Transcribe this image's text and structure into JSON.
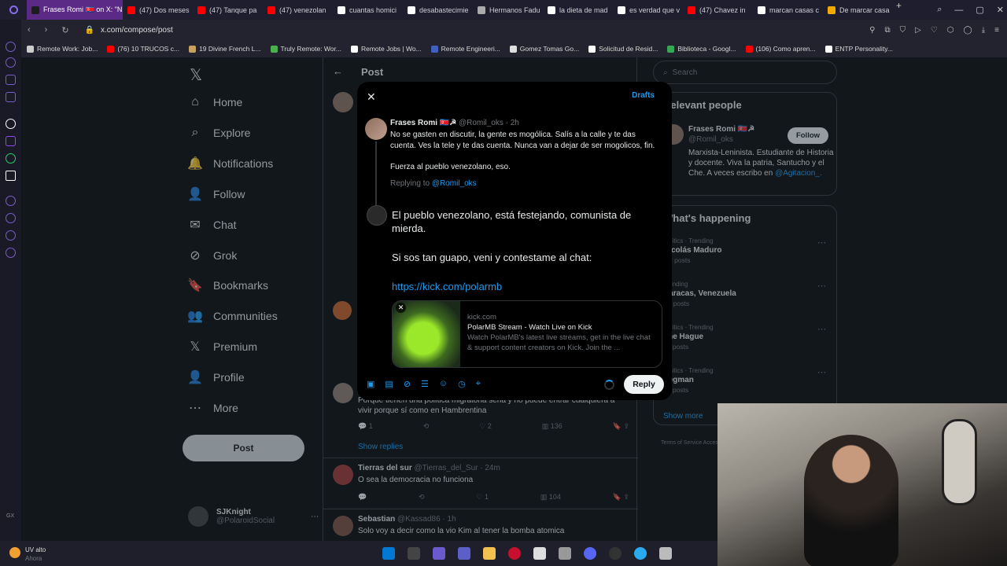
{
  "browser": {
    "tabs": [
      {
        "label": "Frases Romi 🇰🇵 on X: \"N",
        "color": "#1d1d1d",
        "active": true
      },
      {
        "label": "(47) Dos meses",
        "color": "#ff0000"
      },
      {
        "label": "(47) Tanque pa",
        "color": "#ff0000"
      },
      {
        "label": "(47) venezolan",
        "color": "#ff0000"
      },
      {
        "label": "cuantas homici",
        "color": "#ffffff"
      },
      {
        "label": "desabastecimie",
        "color": "#ffffff"
      },
      {
        "label": "Hermanos Fadu",
        "color": "#aaaaaa"
      },
      {
        "label": "la dieta de mad",
        "color": "#ffffff"
      },
      {
        "label": "es verdad que v",
        "color": "#ffffff"
      },
      {
        "label": "(47) Chavez in",
        "color": "#ff0000"
      },
      {
        "label": "marcan casas c",
        "color": "#ffffff"
      },
      {
        "label": "De marcar casa",
        "color": "#f2a900"
      }
    ],
    "url": "x.com/compose/post",
    "bookmarks": [
      {
        "label": "Remote Work: Job...",
        "color": "#cccccc"
      },
      {
        "label": "(76) 10 TRUCOS c...",
        "color": "#ff0000"
      },
      {
        "label": "19 Divine French L...",
        "color": "#c8a060"
      },
      {
        "label": "Truly Remote: Wor...",
        "color": "#4caf50"
      },
      {
        "label": "Remote Jobs | Wo...",
        "color": "#ffffff"
      },
      {
        "label": "Remote Engineeri...",
        "color": "#4060c0"
      },
      {
        "label": "Gomez Tomas Go...",
        "color": "#dddddd"
      },
      {
        "label": "Solicitud de Resid...",
        "color": "#ffffff"
      },
      {
        "label": "Biblioteca - Googl...",
        "color": "#34a853"
      },
      {
        "label": "(106) Como apren...",
        "color": "#ff0000"
      },
      {
        "label": "ENTP Personality...",
        "color": "#ffffff"
      }
    ]
  },
  "sidebar": {
    "items": [
      {
        "label": "Home",
        "icon": "home-icon",
        "glyph": "⌂"
      },
      {
        "label": "Explore",
        "icon": "search-icon",
        "glyph": "⌕"
      },
      {
        "label": "Notifications",
        "icon": "bell-icon",
        "glyph": "🔔"
      },
      {
        "label": "Follow",
        "icon": "follow-icon",
        "glyph": "👤"
      },
      {
        "label": "Chat",
        "icon": "mail-icon",
        "glyph": "✉"
      },
      {
        "label": "Grok",
        "icon": "grok-icon",
        "glyph": "⊘"
      },
      {
        "label": "Bookmarks",
        "icon": "bookmark-icon",
        "glyph": "🔖"
      },
      {
        "label": "Communities",
        "icon": "communities-icon",
        "glyph": "👥"
      },
      {
        "label": "Premium",
        "icon": "x-logo-icon",
        "glyph": "𝕏"
      },
      {
        "label": "Profile",
        "icon": "profile-icon",
        "glyph": "👤"
      },
      {
        "label": "More",
        "icon": "more-icon",
        "glyph": "⋯"
      }
    ],
    "post_label": "Post",
    "account_name": "SJKnight",
    "account_handle": "@PolaroidSocial"
  },
  "timeline": {
    "header": "Post",
    "tweets": [
      {
        "text": "Porque tienen una política migratoria seria y no puede entrar cualquiera a vivir porque sí como en Hambrentina",
        "replies": "1",
        "likes": "2",
        "views": "136",
        "show_replies": "Show replies"
      },
      {
        "name": "Tierras del sur",
        "handle": "@Tierras_del_Sur",
        "time": "· 24m",
        "text": "O sea la democracia no funciona",
        "likes": "1",
        "views": "104"
      },
      {
        "name": "Sebastian",
        "handle": "@Kassad86",
        "time": "· 1h",
        "text": "Solo voy a decir como la vio Kim al tener la bomba atomica"
      }
    ]
  },
  "right": {
    "search_placeholder": "Search",
    "relevant_title": "Relevant people",
    "person_name": "Frases Romi 🇰🇵☭",
    "person_handle": "@Romil_oks",
    "follow_label": "Follow",
    "person_bio": "Marxista-Leninista. Estudiante de Historia y docente. Viva la patria, Santucho y el Che. A veces escribo en",
    "person_bio_link": "@Agitacion_.",
    "happening_title": "What's happening",
    "trends": [
      {
        "meta": "Politics · Trending",
        "name": "Nicolás Maduro",
        "count": "3M posts"
      },
      {
        "meta": "Trending",
        "name": "Caracas, Venezuela",
        "count": "3K posts"
      },
      {
        "meta": "Politics · Trending",
        "name": "The Hague",
        "count": "22 posts"
      },
      {
        "meta": "Politics · Trending",
        "name": "Pegman",
        "count": "91 posts"
      }
    ],
    "show_more": "Show more",
    "footer": "Terms of Service   Accessibility"
  },
  "modal": {
    "drafts_label": "Drafts",
    "orig_name": "Frases Romi 🇰🇵☭",
    "orig_handle": "@Romil_oks · 2h",
    "orig_text_1": "No se gasten en discutir, la gente es mogólica. Salís a la calle y te das cuenta. Ves la tele y te das cuenta. Nunca van a dejar de ser mogolicos, fin.",
    "orig_text_2": "Fuerza al pueblo venezolano, eso.",
    "replying_prefix": "Replying to ",
    "replying_handle": "@Romil_oks",
    "compose_line_1": "El pueblo venezolano, está festejando, comunista de mierda.",
    "compose_line_2": "Si sos tan guapo, veni y contestame al chat:",
    "compose_link": "https://kick.com/polarmb",
    "card_domain": "kick.com",
    "card_title": "PolarMB Stream - Watch Live on Kick",
    "card_desc": "Watch PolarMB's latest live streams, get in the live chat & support content creators on Kick. Join the ...",
    "reply_label": "Reply"
  },
  "taskbar": {
    "weather_label": "UV alto",
    "weather_sub": "Ahora"
  }
}
